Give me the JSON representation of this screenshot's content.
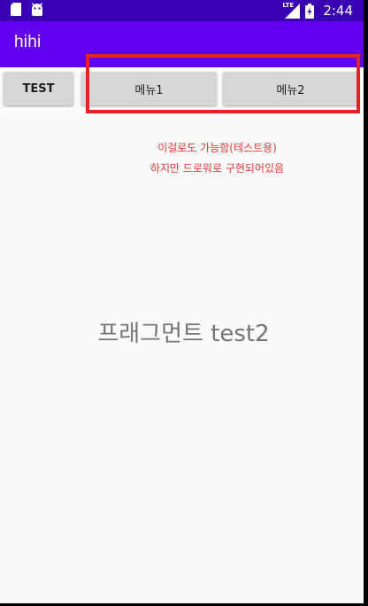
{
  "status_bar": {
    "time": "2:44",
    "network_label": "LTE",
    "left_icons": [
      "sd-card-icon",
      "android-icon"
    ],
    "right_icons": [
      "lte-signal-icon",
      "battery-charging-icon"
    ]
  },
  "app_bar": {
    "title": "hihi"
  },
  "buttons": {
    "test_label": "TEST",
    "menu1_label": "메뉴1",
    "menu2_label": "메뉴2"
  },
  "notes": {
    "line1": "이걸로도 가능함(테스트용)",
    "line2": "하지만 드로워로 구현되어있음"
  },
  "fragment": {
    "text": "프래그먼트 test2"
  },
  "colors": {
    "status_bar": "#3700b3",
    "app_bar": "#6200ee",
    "button_bg": "#d6d7d7",
    "highlight": "#e8202a",
    "note_text": "#e53935",
    "fragment_text": "#757575",
    "background": "#fafafa"
  }
}
